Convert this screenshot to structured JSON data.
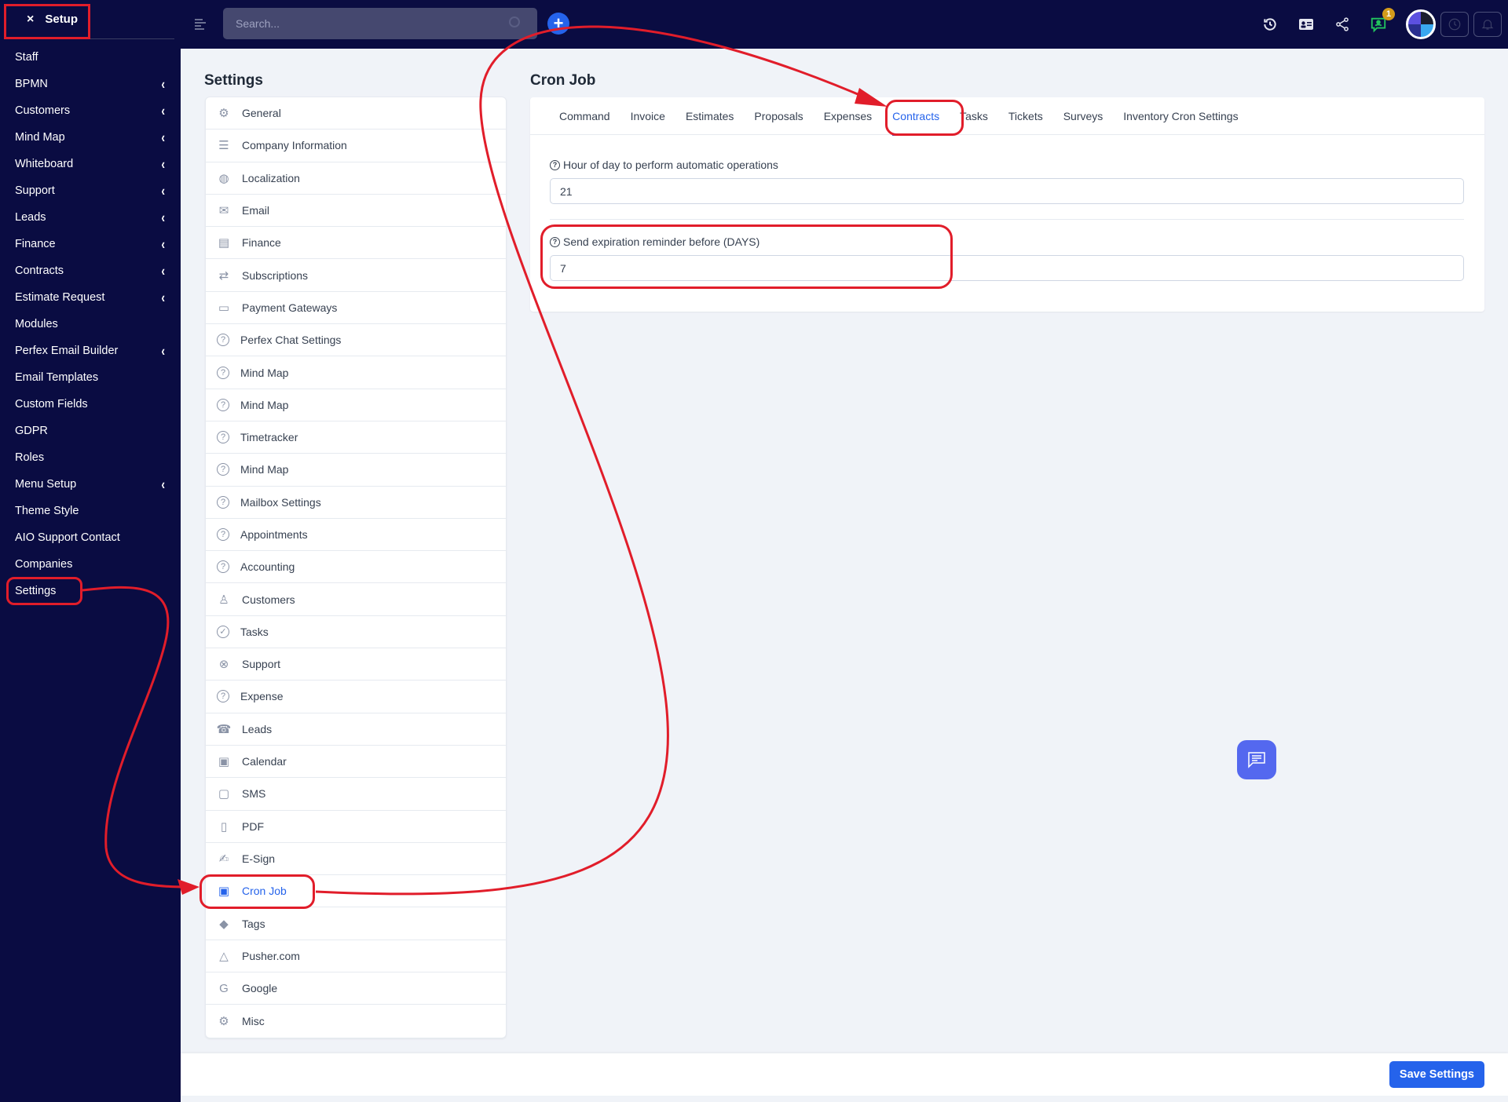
{
  "sidebar": {
    "title": "Setup",
    "close_icon": "×",
    "items": [
      {
        "label": "Staff",
        "chevron": false
      },
      {
        "label": "BPMN",
        "chevron": true
      },
      {
        "label": "Customers",
        "chevron": true
      },
      {
        "label": "Mind Map",
        "chevron": true
      },
      {
        "label": "Whiteboard",
        "chevron": true
      },
      {
        "label": "Support",
        "chevron": true
      },
      {
        "label": "Leads",
        "chevron": true
      },
      {
        "label": "Finance",
        "chevron": true
      },
      {
        "label": "Contracts",
        "chevron": true
      },
      {
        "label": "Estimate Request",
        "chevron": true
      },
      {
        "label": "Modules",
        "chevron": false
      },
      {
        "label": "Perfex Email Builder",
        "chevron": true
      },
      {
        "label": "Email Templates",
        "chevron": false
      },
      {
        "label": "Custom Fields",
        "chevron": false
      },
      {
        "label": "GDPR",
        "chevron": false
      },
      {
        "label": "Roles",
        "chevron": false
      },
      {
        "label": "Menu Setup",
        "chevron": true
      },
      {
        "label": "Theme Style",
        "chevron": false
      },
      {
        "label": "AIO Support Contact",
        "chevron": false
      },
      {
        "label": "Companies",
        "chevron": false
      },
      {
        "label": "Settings",
        "chevron": false
      }
    ]
  },
  "topbar": {
    "search_placeholder": "Search...",
    "notification_count": "1",
    "icons": [
      "history-icon",
      "contact-card-icon",
      "share-icon",
      "chat-support-icon",
      "avatar",
      "clock-icon",
      "bell-icon"
    ]
  },
  "settings": {
    "title": "Settings",
    "items": [
      {
        "label": "General",
        "icon": "gear-icon"
      },
      {
        "label": "Company Information",
        "icon": "lines-icon"
      },
      {
        "label": "Localization",
        "icon": "globe-icon"
      },
      {
        "label": "Email",
        "icon": "envelope-icon"
      },
      {
        "label": "Finance",
        "icon": "receipt-icon"
      },
      {
        "label": "Subscriptions",
        "icon": "repeat-icon"
      },
      {
        "label": "Payment Gateways",
        "icon": "credit-card-icon"
      },
      {
        "label": "Perfex Chat Settings",
        "icon": "question-icon"
      },
      {
        "label": "Mind Map",
        "icon": "question-icon"
      },
      {
        "label": "Mind Map",
        "icon": "question-icon"
      },
      {
        "label": "Timetracker",
        "icon": "question-icon"
      },
      {
        "label": "Mind Map",
        "icon": "question-icon"
      },
      {
        "label": "Mailbox Settings",
        "icon": "question-icon"
      },
      {
        "label": "Appointments",
        "icon": "question-icon"
      },
      {
        "label": "Accounting",
        "icon": "question-icon"
      },
      {
        "label": "Customers",
        "icon": "user-icon"
      },
      {
        "label": "Tasks",
        "icon": "check-circle-icon"
      },
      {
        "label": "Support",
        "icon": "life-ring-icon"
      },
      {
        "label": "Expense",
        "icon": "question-icon"
      },
      {
        "label": "Leads",
        "icon": "phone-icon"
      },
      {
        "label": "Calendar",
        "icon": "calendar-icon"
      },
      {
        "label": "SMS",
        "icon": "message-icon"
      },
      {
        "label": "PDF",
        "icon": "pdf-icon"
      },
      {
        "label": "E-Sign",
        "icon": "signature-icon"
      },
      {
        "label": "Cron Job",
        "icon": "chip-icon",
        "active": true
      },
      {
        "label": "Tags",
        "icon": "tags-icon"
      },
      {
        "label": "Pusher.com",
        "icon": "bell-icon"
      },
      {
        "label": "Google",
        "icon": "google-icon"
      },
      {
        "label": "Misc",
        "icon": "gears-icon"
      }
    ]
  },
  "cron": {
    "title": "Cron Job",
    "tabs": [
      {
        "label": "Command"
      },
      {
        "label": "Invoice"
      },
      {
        "label": "Estimates"
      },
      {
        "label": "Proposals"
      },
      {
        "label": "Expenses"
      },
      {
        "label": "Contracts",
        "active": true
      },
      {
        "label": "Tasks"
      },
      {
        "label": "Tickets"
      },
      {
        "label": "Surveys"
      },
      {
        "label": "Inventory Cron Settings"
      }
    ],
    "fields": [
      {
        "label": "Hour of day to perform automatic operations",
        "value": "21"
      },
      {
        "label": "Send expiration reminder before (DAYS)",
        "value": "7"
      }
    ]
  },
  "footer": {
    "save_label": "Save Settings"
  },
  "colors": {
    "sidebar_bg": "#0a0c42",
    "accent": "#2563eb",
    "annotation": "#e11d2a",
    "chat_fab": "#5468ef"
  }
}
